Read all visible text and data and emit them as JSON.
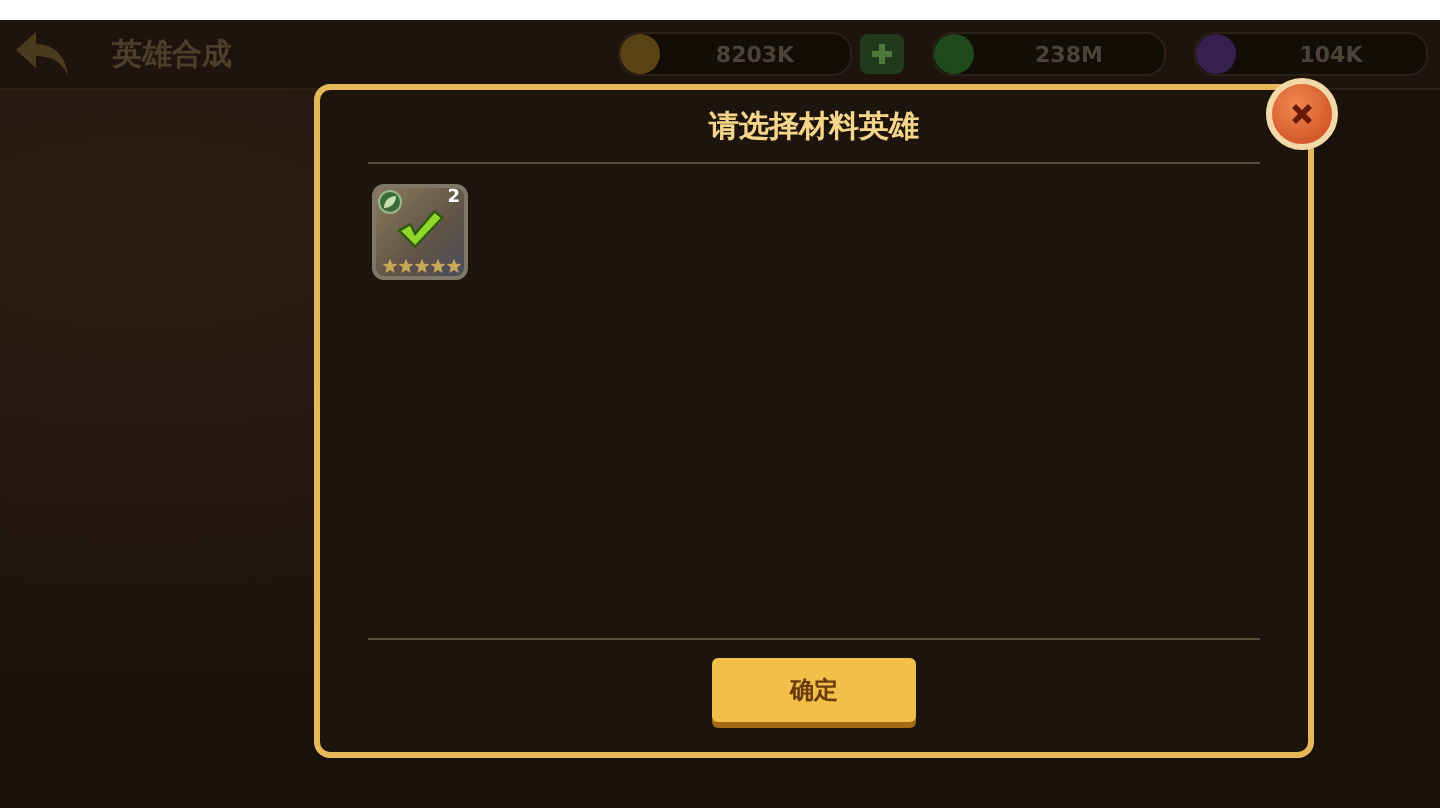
{
  "header": {
    "title": "英雄合成"
  },
  "resources": [
    {
      "kind": "coin",
      "amount": "8203K",
      "addable": true
    },
    {
      "kind": "gem",
      "amount": "238M",
      "addable": false
    },
    {
      "kind": "potion",
      "amount": "104K",
      "addable": false
    }
  ],
  "dialog": {
    "title": "请选择材料英雄",
    "heroes": [
      {
        "level": "2",
        "stars": 5,
        "checked": true
      }
    ],
    "confirm_button": "确定"
  }
}
